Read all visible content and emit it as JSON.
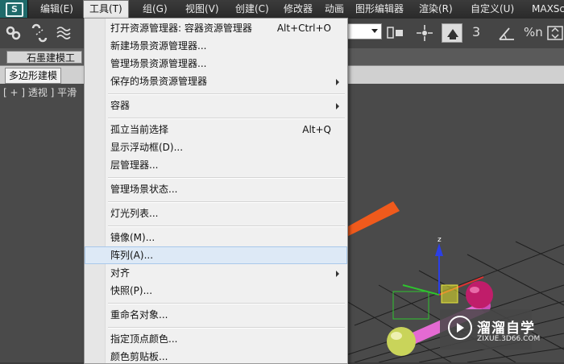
{
  "menubar": {
    "logo": "S",
    "items": [
      {
        "label": "编辑(E)"
      },
      {
        "label": "工具(T)"
      },
      {
        "label": "组(G)"
      },
      {
        "label": "视图(V)"
      },
      {
        "label": "创建(C)"
      },
      {
        "label": "修改器"
      },
      {
        "label": "动画"
      },
      {
        "label": "图形编辑器"
      },
      {
        "label": "渲染(R)"
      },
      {
        "label": "自定义(U)"
      },
      {
        "label": "MAXSc"
      }
    ]
  },
  "toolbar": {
    "right_icons": [
      "3",
      "%n"
    ]
  },
  "ribbon": {
    "tab_label": "石墨建模工具",
    "panel_label": "多边形建模"
  },
  "viewport": {
    "label": "[ + ] 透视 ] 平滑"
  },
  "tools_menu": {
    "items": [
      {
        "label": "打开资源管理器: 容器资源管理器",
        "shortcut": "Alt+Ctrl+O"
      },
      {
        "label": "新建场景资源管理器...",
        "shortcut": ""
      },
      {
        "label": "管理场景资源管理器...",
        "shortcut": ""
      },
      {
        "label": "保存的场景资源管理器",
        "shortcut": ""
      },
      {
        "label": "容器",
        "shortcut": ""
      },
      {
        "label": "孤立当前选择",
        "shortcut": "Alt+Q"
      },
      {
        "label": "显示浮动框(D)...",
        "shortcut": ""
      },
      {
        "label": "层管理器...",
        "shortcut": ""
      },
      {
        "label": "管理场景状态...",
        "shortcut": ""
      },
      {
        "label": "灯光列表...",
        "shortcut": ""
      },
      {
        "label": "镜像(M)...",
        "shortcut": ""
      },
      {
        "label": "阵列(A)...",
        "shortcut": ""
      },
      {
        "label": "对齐",
        "shortcut": ""
      },
      {
        "label": "快照(P)...",
        "shortcut": ""
      },
      {
        "label": "重命名对象...",
        "shortcut": ""
      },
      {
        "label": "指定顶点颜色...",
        "shortcut": ""
      },
      {
        "label": "颜色剪贴板...",
        "shortcut": ""
      }
    ]
  },
  "watermark": {
    "title": "溜溜自学",
    "url": "ZIXUE.3D66.COM"
  },
  "colors": {
    "menu_highlight": "#dde9f6",
    "annotation_arrow": "#f05a1c",
    "gizmo_x": "#e23030",
    "gizmo_y": "#2ec42e",
    "gizmo_z": "#2b3fe6"
  }
}
